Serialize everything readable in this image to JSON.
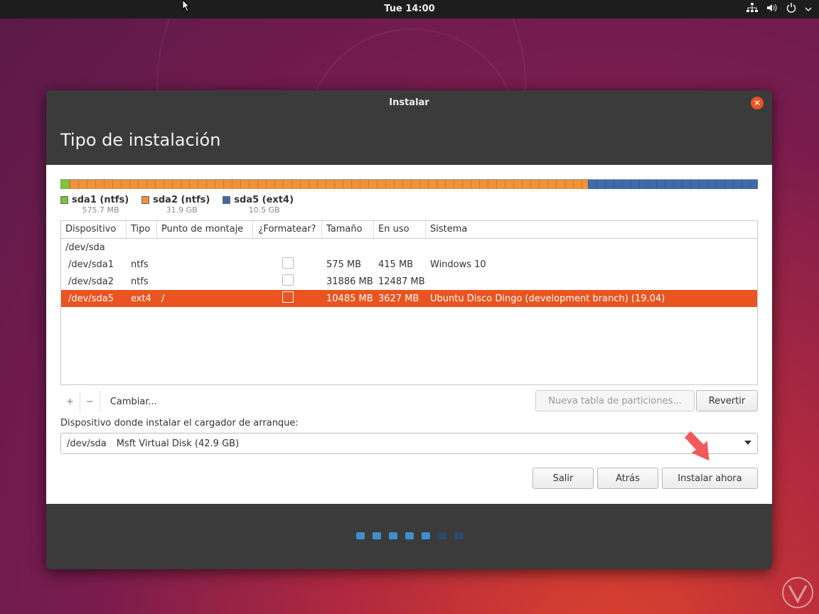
{
  "topbar": {
    "clock": "Tue 14:00"
  },
  "window": {
    "title": "Instalar",
    "page_title": "Tipo de instalación"
  },
  "colors": {
    "sda1": "#7ec33f",
    "sda2": "#f0923a",
    "sda5": "#3f6bab",
    "accent": "#e95420"
  },
  "partitions": [
    {
      "name": "sda1 (ntfs)",
      "size": "575.7 MB"
    },
    {
      "name": "sda2 (ntfs)",
      "size": "31.9 GB"
    },
    {
      "name": "sda5 (ext4)",
      "size": "10.5 GB"
    }
  ],
  "table": {
    "headers": [
      "Dispositivo",
      "Tipo",
      "Punto de montaje",
      "¿Formatear?",
      "Tamaño",
      "En uso",
      "Sistema"
    ],
    "disk": "/dev/sda",
    "rows": [
      {
        "device": "/dev/sda1",
        "type": "ntfs",
        "mount": "",
        "size": "575 MB",
        "used": "415 MB",
        "system": "Windows 10"
      },
      {
        "device": "/dev/sda2",
        "type": "ntfs",
        "mount": "",
        "size": "31886 MB",
        "used": "12487 MB",
        "system": ""
      },
      {
        "device": "/dev/sda5",
        "type": "ext4",
        "mount": "/",
        "size": "10485 MB",
        "used": "3627 MB",
        "system": "Ubuntu Disco Dingo (development branch) (19.04)"
      }
    ]
  },
  "tools": {
    "add": "+",
    "remove": "−",
    "change": "Cambiar..."
  },
  "buttons": {
    "new_table": "Nueva tabla de particiones...",
    "revert": "Revertir",
    "quit": "Salir",
    "back": "Atrás",
    "install": "Instalar ahora"
  },
  "bootloader": {
    "label": "Dispositivo donde instalar el cargador de arranque:",
    "device": "/dev/sda",
    "description": "Msft Virtual Disk (42.9 GB)"
  },
  "progress": {
    "total_steps": 7,
    "completed_steps": 5
  }
}
